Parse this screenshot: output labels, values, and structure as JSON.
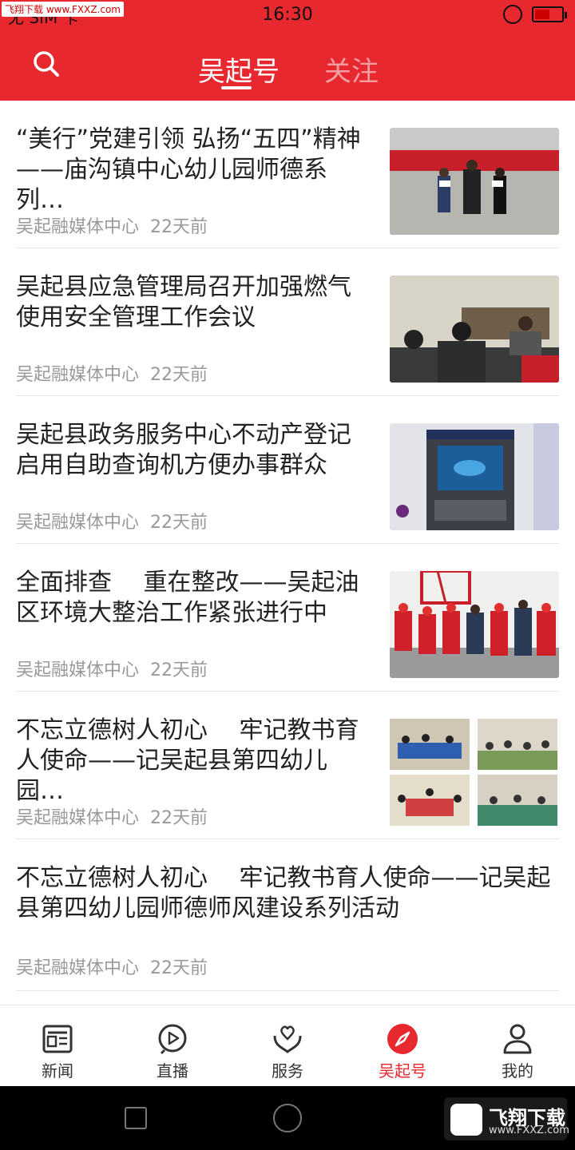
{
  "status_bar": {
    "sim": "无 SIM 卡",
    "time": "16:30",
    "watermark": "飞翔下载 www.FXXZ.com"
  },
  "header": {
    "tabs": [
      {
        "label": "吴起号",
        "active": true
      },
      {
        "label": "关注",
        "active": false
      }
    ],
    "accent_color": "#e8282f"
  },
  "feed": [
    {
      "title": "“美行”党建引领 弘扬“五四”精神——庙沟镇中心幼儿园师德系列…",
      "source": "吴起融媒体中心",
      "time": "22天前"
    },
    {
      "title": "吴起县应急管理局召开加强燃气使用安全管理工作会议",
      "source": "吴起融媒体中心",
      "time": "22天前"
    },
    {
      "title": "吴起县政务服务中心不动产登记启用自助查询机方便办事群众",
      "source": "吴起融媒体中心",
      "time": "22天前"
    },
    {
      "title": "全面排查　 重在整改——吴起油区环境大整治工作紧张进行中",
      "source": "吴起融媒体中心",
      "time": "22天前"
    },
    {
      "title": "不忘立德树人初心　 牢记教书育人使命——记吴起县第四幼儿园…",
      "source": "吴起融媒体中心",
      "time": "22天前"
    },
    {
      "title": "不忘立德树人初心　 牢记教书育人使命——记吴起县第四幼儿园师德师风建设系列活动",
      "source": "吴起融媒体中心",
      "time": "22天前"
    }
  ],
  "bottom_nav": [
    {
      "label": "新闻",
      "icon": "newspaper-icon",
      "active": false
    },
    {
      "label": "直播",
      "icon": "play-icon",
      "active": false
    },
    {
      "label": "服务",
      "icon": "heart-hands-icon",
      "active": false
    },
    {
      "label": "吴起号",
      "icon": "compass-icon",
      "active": true
    },
    {
      "label": "我的",
      "icon": "user-icon",
      "active": false
    }
  ],
  "system_bar": {
    "watermark_title": "飞翔下载",
    "watermark_url": "www.FXXZ.com"
  }
}
